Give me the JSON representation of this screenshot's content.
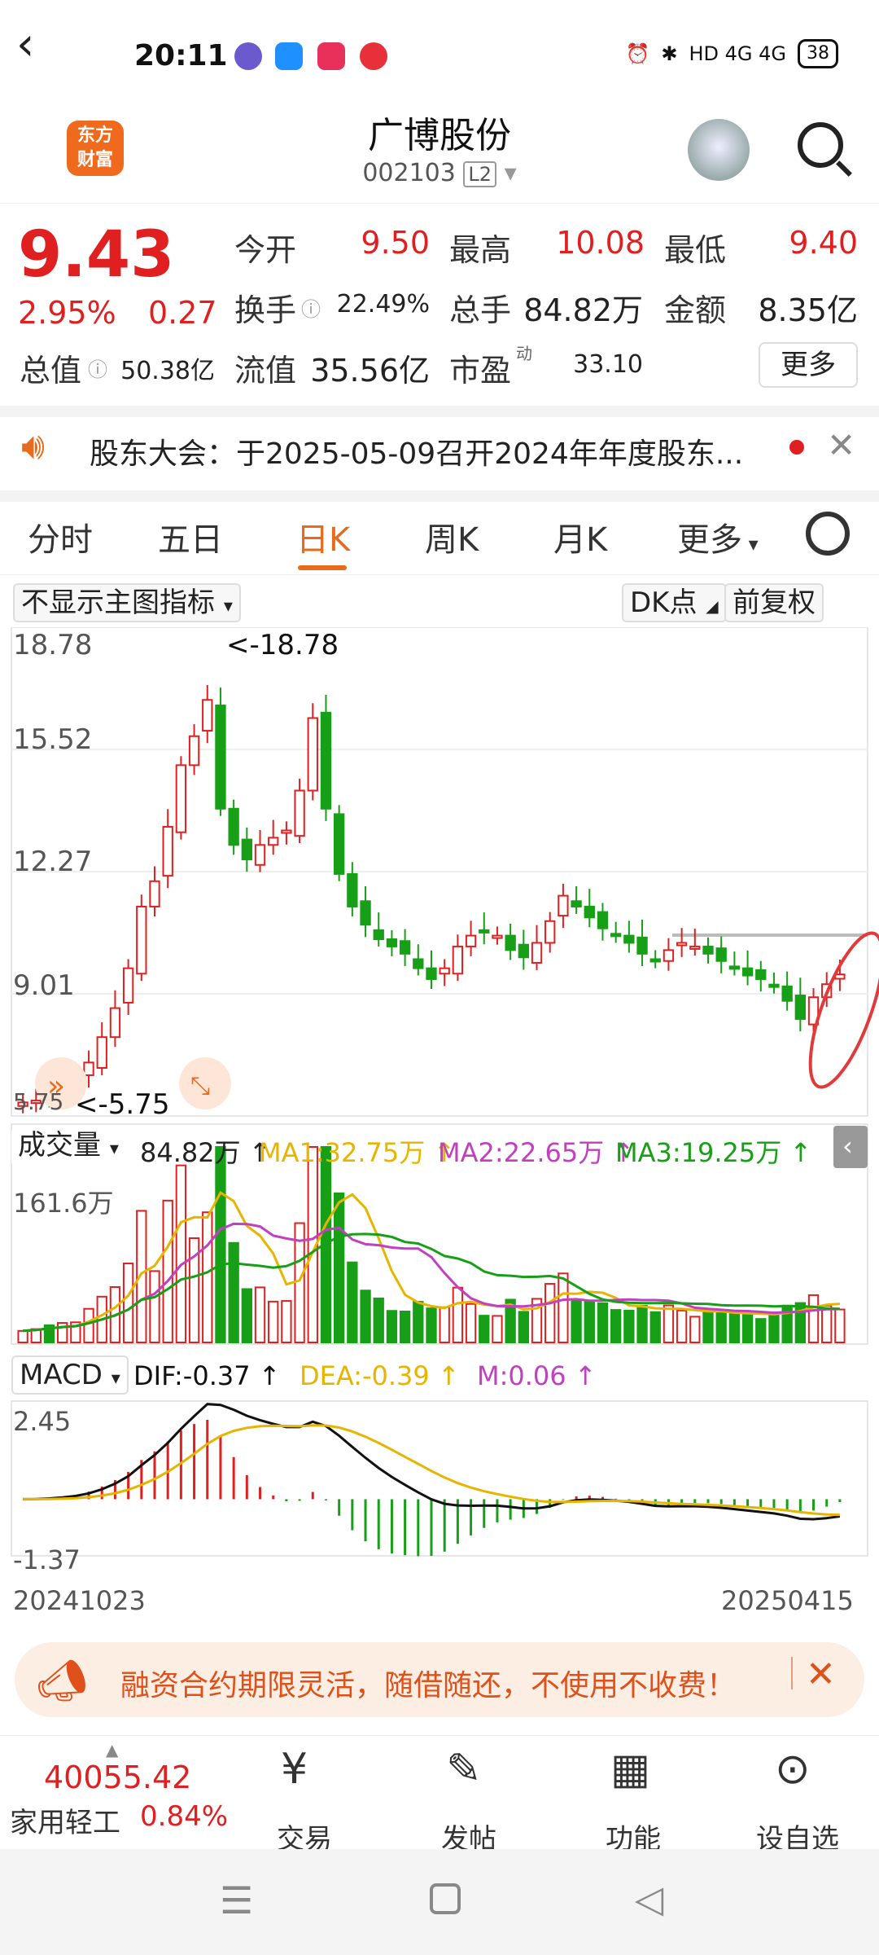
{
  "status_bar": {
    "time": "20:11",
    "network": "HD 4G 4G",
    "battery": "38"
  },
  "header": {
    "logo_text": "东方\n财富",
    "title": "广博股份",
    "code": "002103",
    "level": "L2"
  },
  "quote": {
    "price": "9.43",
    "change_pct": "2.95%",
    "change": "0.27",
    "open_label": "今开",
    "open": "9.50",
    "high_label": "最高",
    "high": "10.08",
    "low_label": "最低",
    "low": "9.40",
    "turnover_label": "换手",
    "turnover": "22.49%",
    "volume_label": "总手",
    "volume": "84.82万",
    "amount_label": "金额",
    "amount": "8.35亿",
    "mktcap_label": "总值",
    "mktcap": "50.38亿",
    "float_label": "流值",
    "float": "35.56亿",
    "pe_label": "市盈",
    "pe_sup": "动",
    "pe": "33.10",
    "more_label": "更多"
  },
  "notice": {
    "text": "股东大会：于2025-05-09召开2024年年度股东..."
  },
  "tabs": [
    "分时",
    "五日",
    "日K",
    "周K",
    "月K",
    "更多"
  ],
  "chart_controls": {
    "indicator": "不显示主图指标",
    "dk": "DK点",
    "adjust": "前复权"
  },
  "chart_data": {
    "type": "candlestick",
    "y_ticks": [
      "18.78",
      "15.52",
      "12.27",
      "9.01",
      "5.75"
    ],
    "max_label": "<-18.78",
    "min_label": "<-5.75",
    "x_start": "20241023",
    "x_end": "20250415",
    "closes": [
      5.9,
      5.95,
      6.1,
      6.3,
      6.5,
      7.0,
      7.7,
      8.5,
      9.6,
      11.3,
      12.0,
      13.5,
      15.2,
      16.0,
      17.0,
      14.0,
      13.0,
      12.6,
      13.0,
      13.2,
      13.4,
      14.5,
      16.5,
      14.0,
      12.2,
      11.3,
      10.8,
      10.4,
      10.2,
      10.0,
      9.6,
      9.3,
      9.6,
      10.2,
      10.5,
      10.6,
      10.5,
      10.1,
      9.9,
      10.3,
      10.9,
      11.6,
      11.3,
      11.0,
      10.7,
      10.5,
      10.3,
      10.0,
      9.8,
      10.1,
      10.3,
      10.2,
      10.0,
      9.8,
      9.6,
      9.4,
      9.3,
      9.1,
      8.7,
      8.2,
      8.8,
      9.16,
      9.43
    ],
    "volume": {
      "label": "成交量",
      "value": "84.82万",
      "top": "161.6万",
      "ma1": "MA1:32.75万",
      "ma2": "MA2:22.65万",
      "ma3": "MA3:19.25万"
    },
    "macd": {
      "label": "MACD",
      "dif": "DIF:-0.37",
      "dea": "DEA:-0.39",
      "m": "M:0.06",
      "top": "2.45",
      "bottom": "-1.37"
    }
  },
  "ad": {
    "text": "融资合约期限灵活，随借随还，不使用不收费！"
  },
  "tabbar": {
    "index_value": "40055.42",
    "index_name": "家用轻工",
    "index_pct": "0.84%",
    "items": [
      "交易",
      "发帖",
      "功能",
      "设自选"
    ]
  },
  "colors": {
    "up": "#e02020",
    "down": "#17a017",
    "accent": "#e86a1c"
  }
}
